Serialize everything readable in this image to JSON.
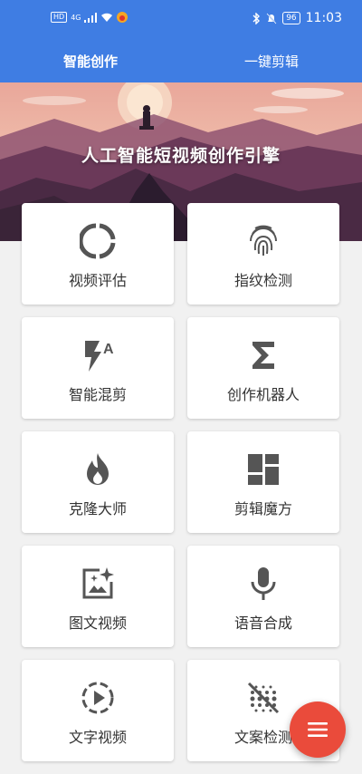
{
  "status_bar": {
    "left_badge": "HD",
    "network": "4G",
    "battery": "96",
    "time": "11:03"
  },
  "tabs": [
    {
      "label": "智能创作",
      "active": true
    },
    {
      "label": "一键剪辑",
      "active": false
    }
  ],
  "hero": {
    "title": "人工智能短视频创作引擎"
  },
  "cards": [
    {
      "label": "视频评估",
      "icon": "donut-chart-icon"
    },
    {
      "label": "指纹检测",
      "icon": "fingerprint-icon"
    },
    {
      "label": "智能混剪",
      "icon": "flash-auto-icon"
    },
    {
      "label": "创作机器人",
      "icon": "sigma-icon"
    },
    {
      "label": "克隆大师",
      "icon": "flame-icon"
    },
    {
      "label": "剪辑魔方",
      "icon": "dashboard-blocks-icon"
    },
    {
      "label": "图文视频",
      "icon": "sparkle-image-icon"
    },
    {
      "label": "语音合成",
      "icon": "microphone-icon"
    },
    {
      "label": "文字视频",
      "icon": "play-circle-dashed-icon"
    },
    {
      "label": "文案检测",
      "icon": "blur-off-icon"
    }
  ],
  "fab": {
    "icon": "menu-icon"
  },
  "colors": {
    "primary": "#3f7de3",
    "fab": "#ea4b3b",
    "icon": "#555555",
    "background": "#f1f1f1"
  }
}
